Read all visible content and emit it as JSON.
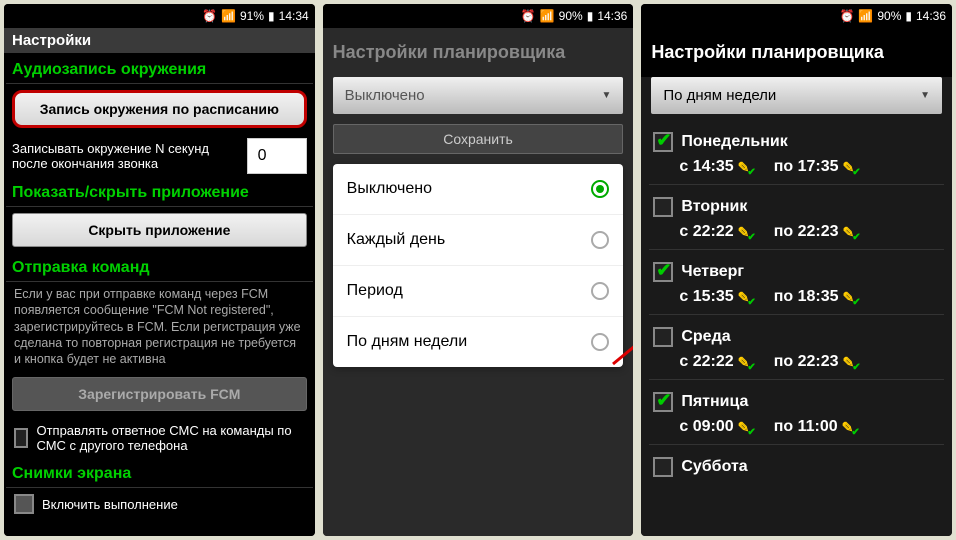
{
  "statusbar": {
    "battery1": "91%",
    "battery2": "90%",
    "battery3": "90%",
    "time1": "14:34",
    "time2": "14:36",
    "time3": "14:36"
  },
  "p1": {
    "title": "Настройки",
    "sec1": "Аудиозапись окружения",
    "btn1": "Запись окружения по расписанию",
    "row1": "Записывать окружение N секунд после окончания звонка",
    "row1val": "0",
    "sec2": "Показать/скрыть приложение",
    "btn2": "Скрыть приложение",
    "sec3": "Отправка команд",
    "desc3": "Если у вас при отправке команд через FCM появляется сообщение \"FCM Not registered\", зарегистрируйтесь в FCM. Если регистрация уже сделана то повторная регистрация не требуется и кнопка будет не активна",
    "btn3": "Зарегистрировать FCM",
    "chk1": "Отправлять ответное СМС на команды по СМС с другого телефона",
    "sec4": "Снимки экрана",
    "chk2": "Включить выполнение"
  },
  "p2": {
    "title": "Настройки планировщика",
    "dropdown": "Выключено",
    "save": "Сохранить",
    "options": [
      "Выключено",
      "Каждый день",
      "Период",
      "По дням недели"
    ],
    "selected": 0
  },
  "p3": {
    "title": "Настройки планировщика",
    "dropdown": "По дням недели",
    "from": "с",
    "to": "по",
    "days": [
      {
        "name": "Понедельник",
        "checked": true,
        "from": "14:35",
        "to": "17:35"
      },
      {
        "name": "Вторник",
        "checked": false,
        "from": "22:22",
        "to": "22:23"
      },
      {
        "name": "Четверг",
        "checked": true,
        "from": "15:35",
        "to": "18:35"
      },
      {
        "name": "Среда",
        "checked": false,
        "from": "22:22",
        "to": "22:23"
      },
      {
        "name": "Пятница",
        "checked": true,
        "from": "09:00",
        "to": "11:00"
      },
      {
        "name": "Суббота",
        "checked": false,
        "from": "",
        "to": ""
      }
    ]
  }
}
